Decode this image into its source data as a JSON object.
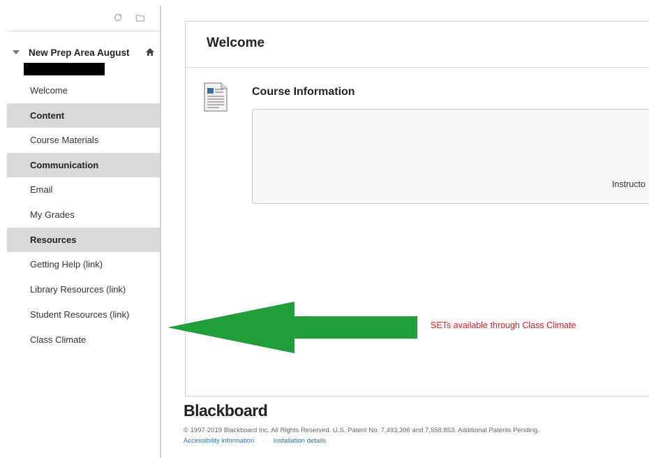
{
  "sidebar": {
    "course_title": "New Prep Area August",
    "items": [
      {
        "label": "Welcome",
        "type": "link"
      },
      {
        "label": "Content",
        "type": "header"
      },
      {
        "label": "Course Materials",
        "type": "link"
      },
      {
        "label": "Communication",
        "type": "header"
      },
      {
        "label": "Email",
        "type": "link"
      },
      {
        "label": "My Grades",
        "type": "link"
      },
      {
        "label": "Resources",
        "type": "header"
      },
      {
        "label": "Getting Help (link)",
        "type": "link"
      },
      {
        "label": "Library Resources (link)",
        "type": "link"
      },
      {
        "label": "Student Resources (link)",
        "type": "link"
      },
      {
        "label": "Class Climate",
        "type": "link"
      }
    ]
  },
  "main": {
    "page_title": "Welcome",
    "item_title": "Course Information",
    "item_body_text": "Instructo",
    "annotation": "SETs available through Class Climate"
  },
  "footer": {
    "logo": "Blackboard",
    "copyright": "© 1997-2019 Blackboard Inc. All Rights Reserved. U.S. Patent No. 7,493,396 and 7,558,853. Additional Patents Pending.",
    "link_accessibility": "Accessibility information",
    "link_installation": "Installation details"
  },
  "colors": {
    "arrow": "#1f9e3a",
    "annotation": "#e02020",
    "nav_header_bg": "#d9d9d9"
  }
}
